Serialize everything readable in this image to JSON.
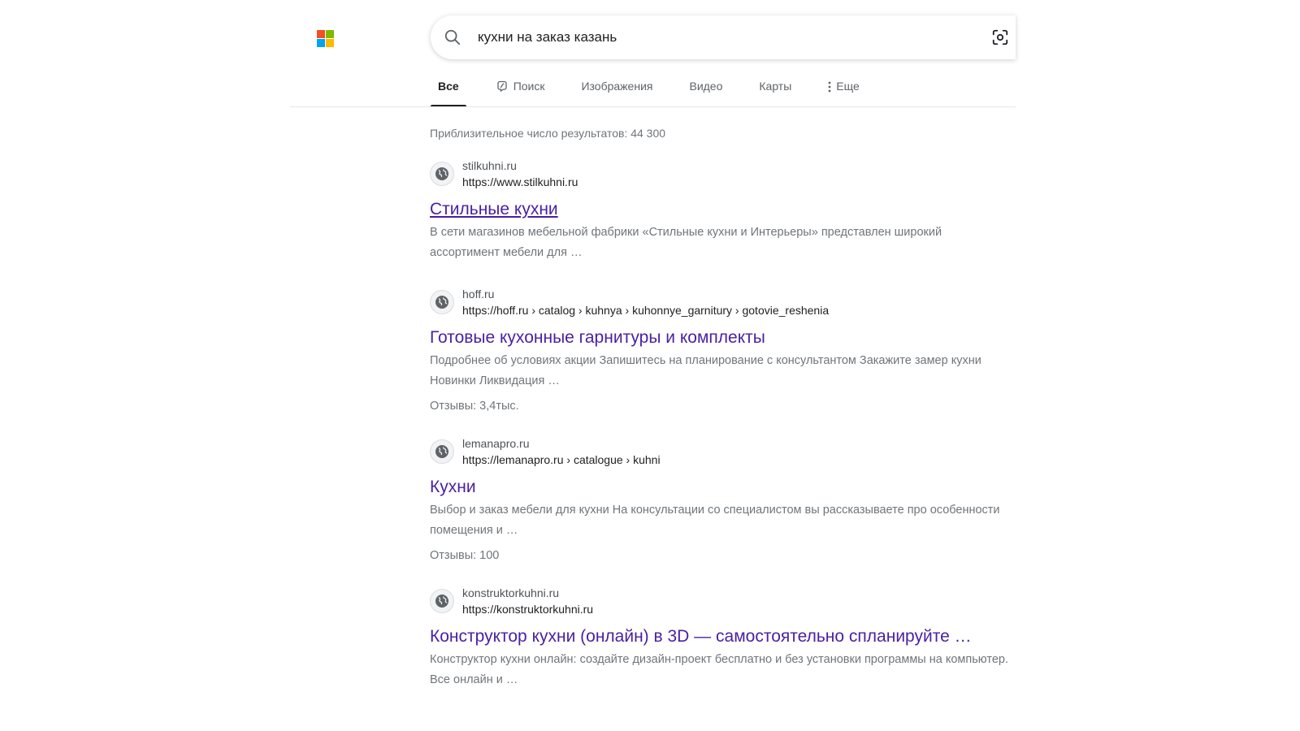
{
  "header": {
    "logo_colors": [
      "#f25022",
      "#7fba00",
      "#00a4ef",
      "#ffb900"
    ]
  },
  "search": {
    "query": "кухни на заказ казань",
    "placeholder": ""
  },
  "tabs": [
    {
      "label": "Все",
      "active": true
    },
    {
      "label": "Поиск",
      "active": false,
      "icon": "copilot-icon"
    },
    {
      "label": "Изображения",
      "active": false
    },
    {
      "label": "Видео",
      "active": false
    },
    {
      "label": "Карты",
      "active": false
    },
    {
      "label": "Еще",
      "active": false,
      "icon": "more-vertical-icon"
    }
  ],
  "results_info": {
    "count_text": "Приблизительное число результатов: 44 300"
  },
  "results": [
    {
      "site": "stilkuhni.ru",
      "url": "https://www.stilkuhni.ru",
      "title": "Стильные кухни",
      "snippet": "В сети магазинов мебельной фабрики «Стильные кухни и Интерьеры» представлен широкий ассортимент мебели для …",
      "reviews": ""
    },
    {
      "site": "hoff.ru",
      "url": "https://hoff.ru › catalog › kuhnya › kuhonnye_garnitury › gotovie_reshenia",
      "title": "Готовые кухонные гарнитуры и комплекты",
      "snippet": "Подробнее об условиях акции Запишитесь на планирование с консультантом Закажите замер кухни Новинки Ликвидация …",
      "reviews": "Отзывы: 3,4тыс."
    },
    {
      "site": "lemanapro.ru",
      "url": "https://lemanapro.ru › catalogue › kuhni",
      "title": "Кухни",
      "snippet": "Выбор и заказ мебели для кухни На консультации со специалистом вы рассказываете про особенности помещения и …",
      "reviews": "Отзывы: 100"
    },
    {
      "site": "konstruktorkuhni.ru",
      "url": "https://konstruktorkuhni.ru",
      "title": "Конструктор кухни (онлайн) в 3D — самостоятельно спланируйте …",
      "snippet": "Конструктор кухни онлайн: создайте дизайн-проект бесплатно и без установки программы на компьютер. Все онлайн и …",
      "reviews": ""
    }
  ],
  "colors": {
    "title_link": "#4a1fa3",
    "snippet": "#70757a"
  }
}
